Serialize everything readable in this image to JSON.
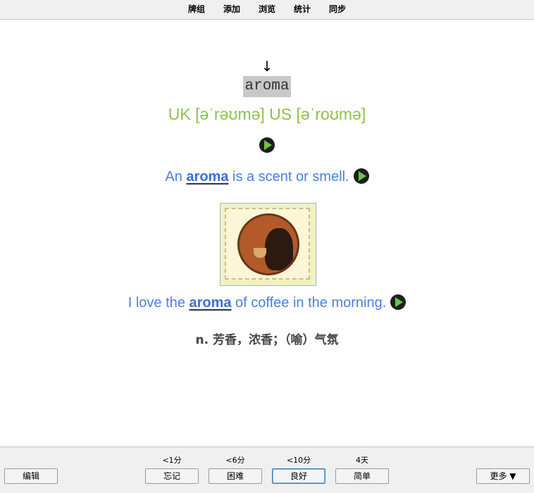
{
  "topbar": {
    "items": [
      {
        "label": "牌组"
      },
      {
        "label": "添加"
      },
      {
        "label": "浏览"
      },
      {
        "label": "统计"
      },
      {
        "label": "同步"
      }
    ]
  },
  "card": {
    "arrow": "↓",
    "word": "aroma",
    "phonetic": "UK [əˈrəʊmə] US [əˈroʊmə]",
    "sentence1": {
      "before": "An ",
      "highlight": "aroma",
      "after": " is a scent or smell."
    },
    "image_icon": "coffee-lady-stamp",
    "sentence2": {
      "before": "I love the ",
      "highlight": "aroma",
      "after": " of coffee in the morning."
    },
    "definition": "n. 芳香，浓香；（喻）气氛"
  },
  "bottombar": {
    "edit_label": "编辑",
    "more_label": "更多 ▼",
    "answers": [
      {
        "interval": "<1分",
        "label": "忘记"
      },
      {
        "interval": "<6分",
        "label": "困难"
      },
      {
        "interval": "<10分",
        "label": "良好"
      },
      {
        "interval": "4天",
        "label": "简单"
      }
    ]
  },
  "colors": {
    "phonetic": "#8bc34a",
    "sentence": "#4a7fe0",
    "play_triangle": "#6cc644"
  }
}
